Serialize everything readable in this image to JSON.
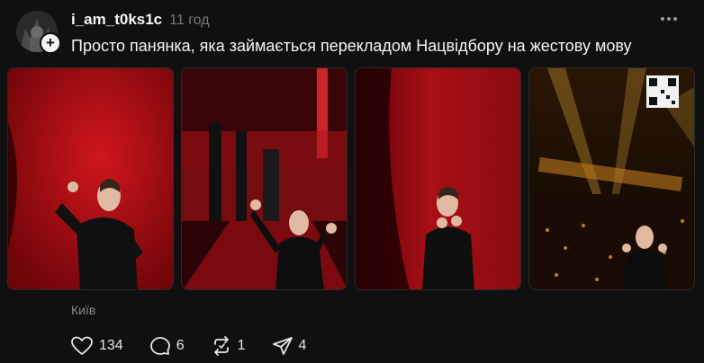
{
  "post": {
    "username": "i_am_t0ks1c",
    "time": "11 год",
    "caption": "Просто панянка, яка займається перекладом Нацвідбору на жестову мову",
    "location": "Київ",
    "follow_badge": "+"
  },
  "photos": [
    {
      "icon": "photo-sign-language-interpreter"
    },
    {
      "icon": "photo-stage-performers"
    },
    {
      "icon": "photo-interpreter-closeup"
    },
    {
      "icon": "photo-arena-crowd"
    }
  ],
  "actions": {
    "likes": "134",
    "comments": "6",
    "reposts": "1",
    "shares": "4"
  },
  "colors": {
    "background": "#101010",
    "text": "#f3f5f7",
    "muted": "#777777",
    "stage_red": "#c0141a"
  }
}
